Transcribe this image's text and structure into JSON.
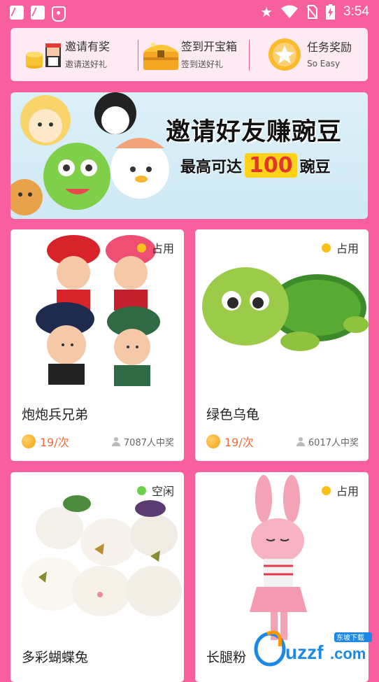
{
  "status_bar": {
    "time": "3:54"
  },
  "quick_actions": [
    {
      "title": "邀请有奖",
      "subtitle": "邀请送好礼"
    },
    {
      "title": "签到开宝箱",
      "subtitle": "签到送好礼"
    },
    {
      "title": "任务奖励",
      "subtitle": "So Easy"
    }
  ],
  "banner": {
    "title": "邀请好友赚豌豆",
    "sub_prefix": "最高可达",
    "sub_number": "100",
    "sub_suffix": "豌豆"
  },
  "products": [
    {
      "name": "炮炮兵兄弟",
      "status": "占用",
      "status_color": "#f7c01b",
      "price": "19/次",
      "winners": "7087人中奖"
    },
    {
      "name": "绿色乌龟",
      "status": "占用",
      "status_color": "#f7c01b",
      "price": "19/次",
      "winners": "6017人中奖"
    },
    {
      "name": "多彩蝴蝶兔",
      "status": "空闲",
      "status_color": "#6fce4a"
    },
    {
      "name": "长腿粉",
      "status": "占用",
      "status_color": "#f7c01b"
    }
  ],
  "watermark": {
    "brand": "uzzf",
    "domain": ".com",
    "tag": "东坡下载"
  }
}
